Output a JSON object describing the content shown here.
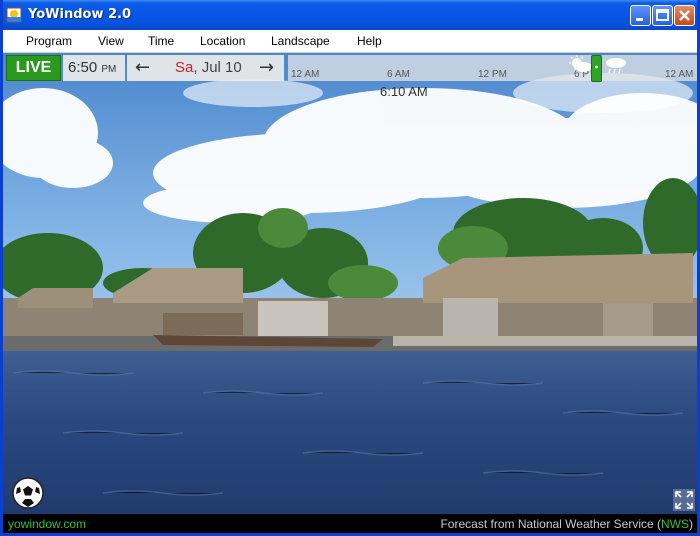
{
  "window": {
    "title": "YoWindow 2.0"
  },
  "menu": [
    "Program",
    "View",
    "Time",
    "Location",
    "Landscape",
    "Help"
  ],
  "timebar": {
    "live_label": "LIVE",
    "clock_time": "6:50",
    "clock_ampm": "PM",
    "date_dow": "Sa",
    "date_rest": ", Jul 10",
    "prev_arrow": "←",
    "next_arrow": "→",
    "ticks": [
      "12 AM",
      "6 AM",
      "12 PM",
      "6 P",
      "12 AM"
    ],
    "cursor_time": "6:10 AM"
  },
  "status": {
    "site": "yowindow.com",
    "forecast_prefix": "Forecast from National Weather Service (",
    "forecast_source": "NWS",
    "forecast_suffix": ")"
  },
  "colors": {
    "titlebar": "#0756e8",
    "live": "#2a9a1e",
    "accent_date": "#c2262d",
    "status_link": "#3bbf2e"
  }
}
